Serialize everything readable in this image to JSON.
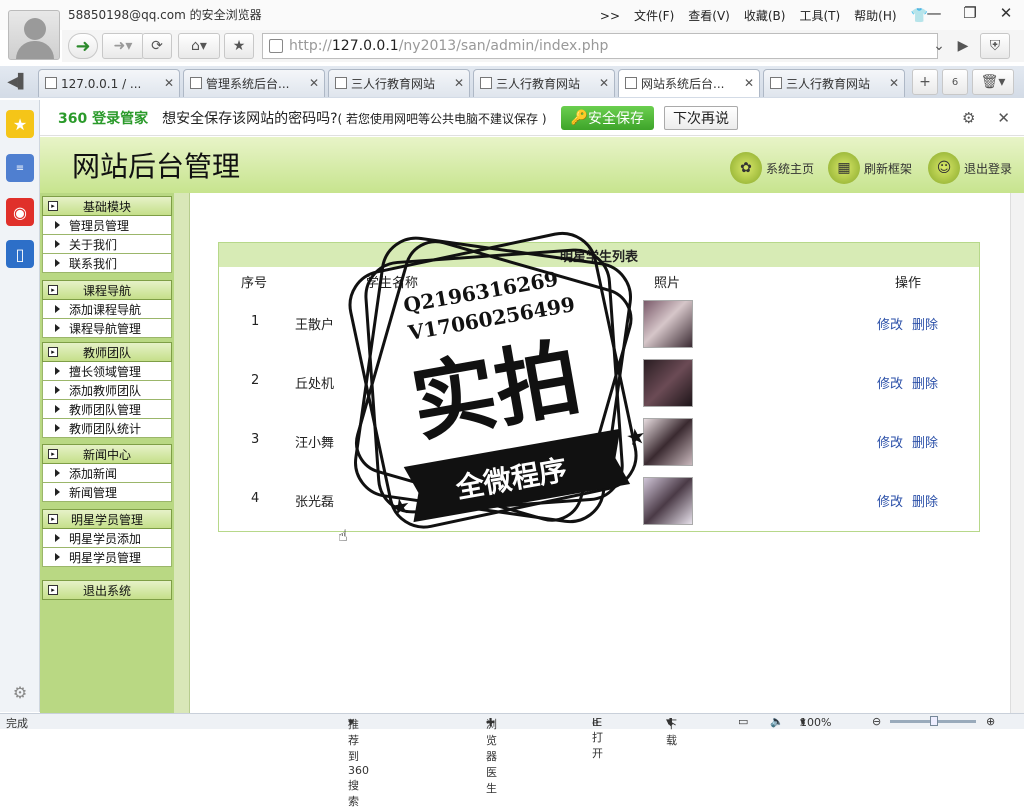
{
  "window": {
    "title": "58850198@qq.com 的安全浏览器",
    "menus": [
      ">>",
      "文件(F)",
      "查看(V)",
      "收藏(B)",
      "工具(T)",
      "帮助(H)"
    ],
    "controls": {
      "minimize": "—",
      "restore": "❐",
      "close": "✕"
    }
  },
  "nav": {
    "url_prefix": "http://",
    "url_host": "127.0.0.1",
    "url_path": "/ny2013/san/admin/index.php"
  },
  "tabs": [
    {
      "label": "127.0.0.1 / ..."
    },
    {
      "label": "管理系统后台..."
    },
    {
      "label": "三人行教育网站"
    },
    {
      "label": "三人行教育网站"
    },
    {
      "label": "网站系统后台..."
    },
    {
      "label": "三人行教育网站"
    }
  ],
  "tabbar": {
    "count_badge": "6"
  },
  "password_bar": {
    "brand_num": "360",
    "brand": "登录管家",
    "question": "想安全保存该网站的密码吗?",
    "hint": "( 若您使用网吧等公共电脑不建议保存 )",
    "save": "安全保存",
    "later": "下次再说"
  },
  "site": {
    "title": "网站后台管理",
    "header_buttons": [
      {
        "label": "系统主页"
      },
      {
        "label": "刷新框架"
      },
      {
        "label": "退出登录"
      }
    ]
  },
  "menu": {
    "groups": [
      {
        "title": "基础模块",
        "items": [
          "管理员管理",
          "关于我们",
          "联系我们"
        ]
      },
      {
        "title": "课程导航",
        "items": [
          "添加课程导航",
          "课程导航管理"
        ]
      },
      {
        "title": "教师团队",
        "items": [
          "擅长领域管理",
          "添加教师团队",
          "教师团队管理",
          "教师团队统计"
        ]
      },
      {
        "title": "新闻中心",
        "items": [
          "添加新闻",
          "新闻管理"
        ]
      },
      {
        "title": "明星学员管理",
        "items": [
          "明星学员添加",
          "明星学员管理"
        ]
      },
      {
        "title": "退出系统",
        "items": []
      }
    ]
  },
  "table": {
    "title": "明星学生列表",
    "headers": [
      "序号",
      "学生名称",
      "照片",
      "操作"
    ],
    "rows": [
      {
        "num": "1",
        "name": "王散户",
        "edit": "修改",
        "delete": "删除"
      },
      {
        "num": "2",
        "name": "丘处机",
        "edit": "修改",
        "delete": "删除"
      },
      {
        "num": "3",
        "name": "汪小舞",
        "edit": "修改",
        "delete": "删除"
      },
      {
        "num": "4",
        "name": "张光磊",
        "edit": "修改",
        "delete": "删除"
      }
    ]
  },
  "watermark": {
    "line1": "Q2196316269",
    "line2": "V17060256499",
    "main": "实拍",
    "ribbon": "全微程序"
  },
  "status": {
    "left": "完成",
    "recommend": "推荐到360搜索",
    "doctor": "浏览器医生",
    "ie": "IE打开",
    "download": "下载",
    "zoom": "100%"
  }
}
